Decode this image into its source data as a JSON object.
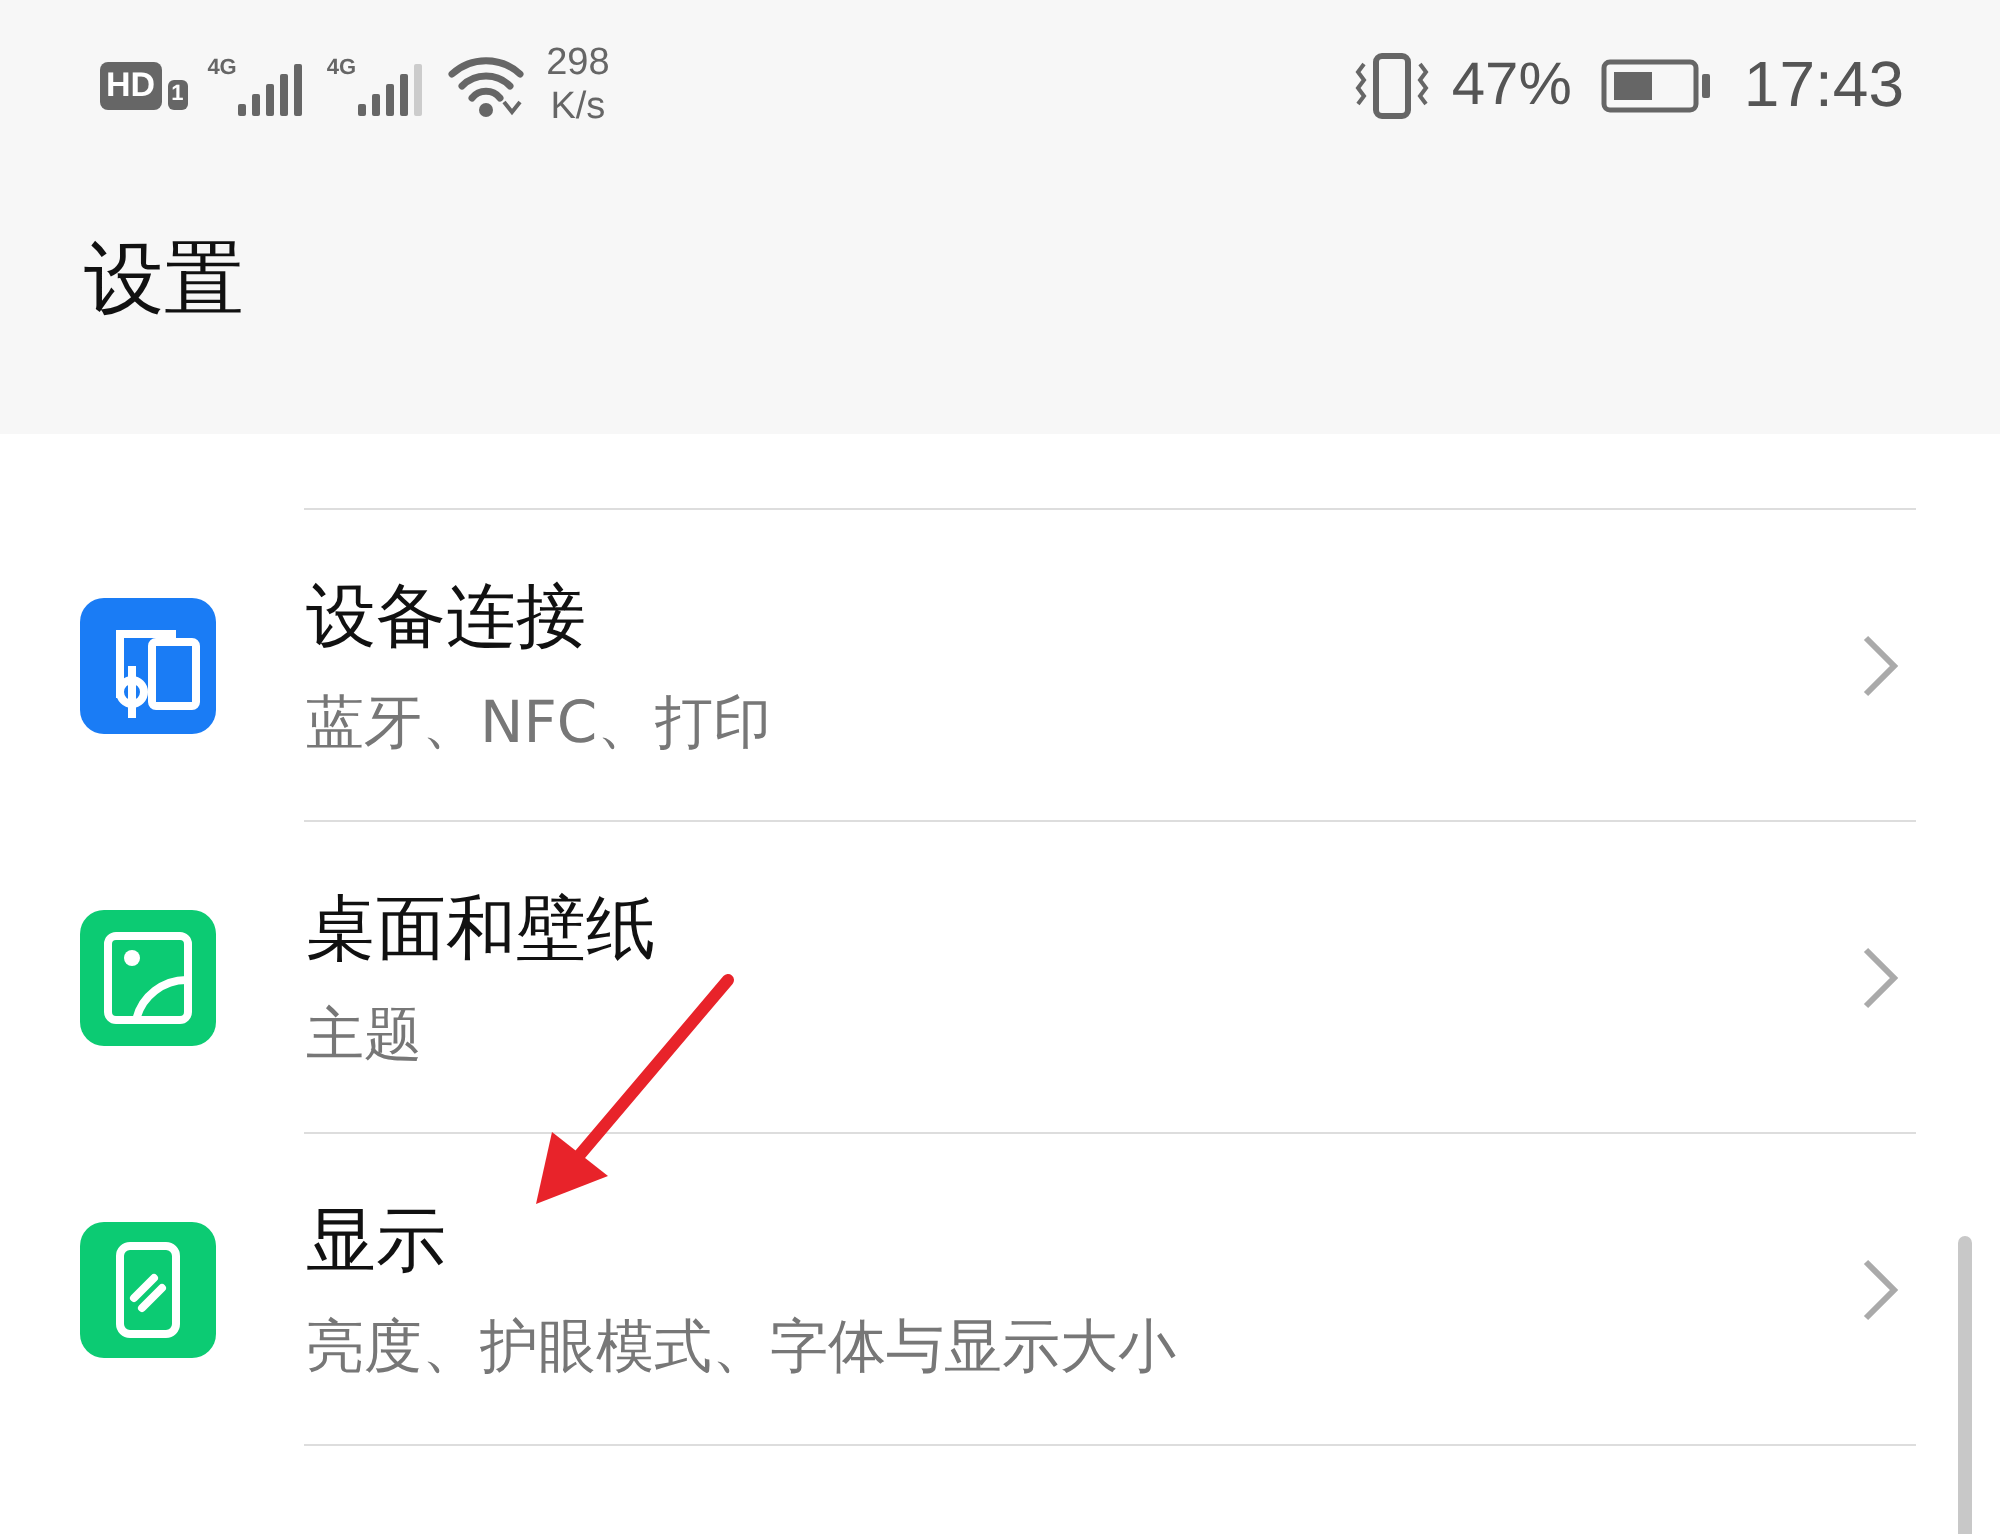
{
  "status_bar": {
    "hd_label": "HD",
    "sim_slot": "1",
    "network_types": [
      "4G",
      "4G"
    ],
    "network_speed_value": "298",
    "network_speed_unit": "K/s",
    "battery_percent": "47%",
    "time": "17:43"
  },
  "header": {
    "title": "设置"
  },
  "settings": [
    {
      "title": "设备连接",
      "subtitle": "蓝牙、NFC、打印",
      "kind": "devices",
      "color": "#1a7cf5"
    },
    {
      "title": "桌面和壁纸",
      "subtitle": "主题",
      "kind": "wallpaper",
      "color": "#0ccb73"
    },
    {
      "title": "显示",
      "subtitle": "亮度、护眼模式、字体与显示大小",
      "kind": "display",
      "color": "#0ccb73"
    }
  ]
}
